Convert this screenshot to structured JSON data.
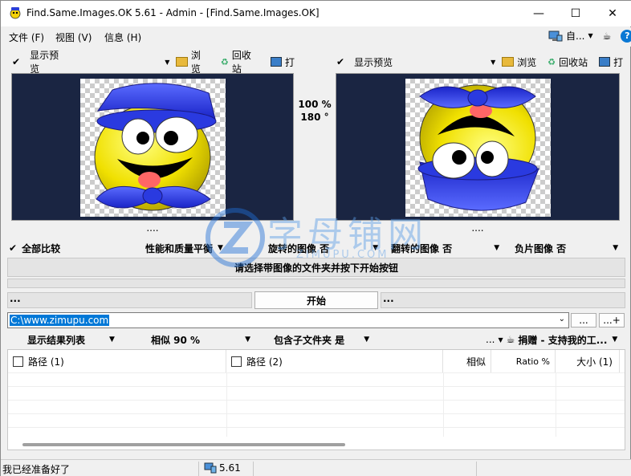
{
  "window": {
    "title": "Find.Same.Images.OK 5.61 - Admin - [Find.Same.Images.OK]",
    "minimize": "—",
    "maximize": "☐",
    "close": "✕"
  },
  "menu": {
    "file": "文件 (F)",
    "view": "视图 (V)",
    "info": "信息 (H)",
    "auto": "自...",
    "help": "?"
  },
  "left_preview": {
    "show_label": "显示预览",
    "browse": "浏览",
    "recycle": "回收站",
    "print": "打",
    "dots": "...."
  },
  "right_preview": {
    "show_label": "显示预览",
    "browse": "浏览",
    "recycle": "回收站",
    "print": "打",
    "dots": "...."
  },
  "center": {
    "zoom": "100 %",
    "angle": "180 °"
  },
  "compare": {
    "all": "全部比较",
    "perf": "性能和质量平衡",
    "rotate": "旋转的图像 否",
    "flip": "翻转的图像 否",
    "negative": "负片图像 否"
  },
  "instruction": "请选择带图像的文件夹并按下开始按钮",
  "start": {
    "left_dots": "...",
    "label": "开始",
    "right_dots": "..."
  },
  "path": {
    "value": "C:\\www.zimupu.com",
    "browse_btn": "...",
    "add_btn": "...+"
  },
  "options": {
    "show_list": "显示结果列表",
    "similar": "相似 90 %",
    "subfolders": "包含子文件夹 是",
    "more": "...",
    "donate": "捐赠 - 支持我的工..."
  },
  "table": {
    "headers": [
      "路径 (1)",
      "路径 (2)",
      "相似",
      "Ratio %",
      "大小 (1)"
    ]
  },
  "status": {
    "ready": "我已经准备好了",
    "version": "5.61"
  },
  "watermark": {
    "main": "字母铺网",
    "sub": "ZIMUPU.COM"
  }
}
